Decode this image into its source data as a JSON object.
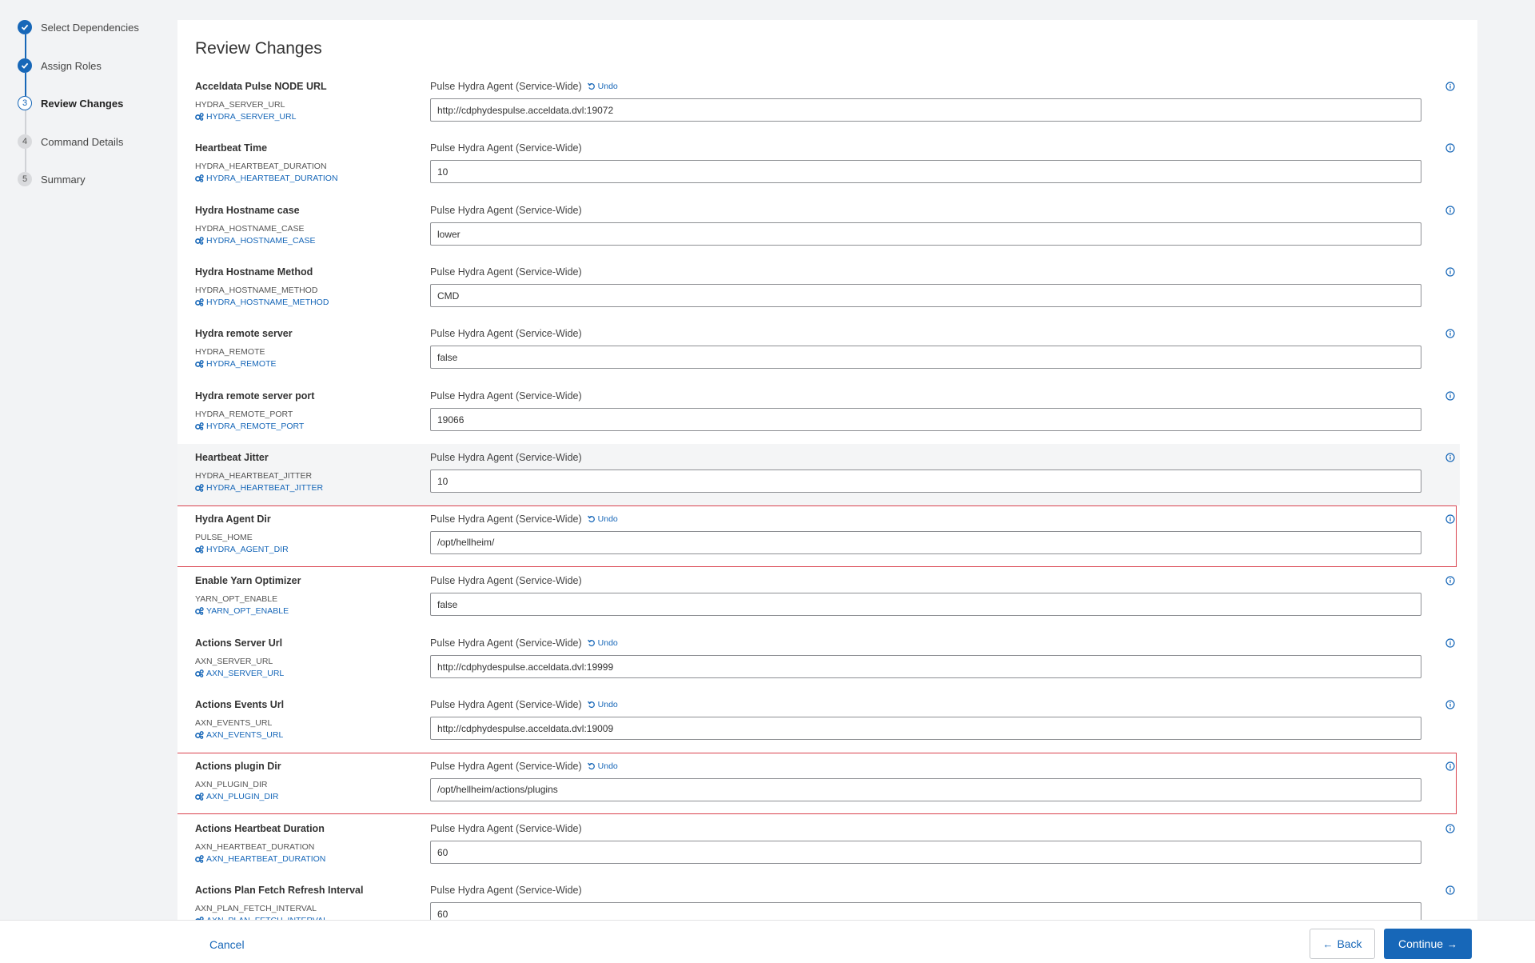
{
  "steps": [
    {
      "number": "1",
      "label": "Select Dependencies",
      "status": "done"
    },
    {
      "number": "2",
      "label": "Assign Roles",
      "status": "done"
    },
    {
      "number": "3",
      "label": "Review Changes",
      "status": "current"
    },
    {
      "number": "4",
      "label": "Command Details",
      "status": "future"
    },
    {
      "number": "5",
      "label": "Summary",
      "status": "future"
    }
  ],
  "page_title": "Review Changes",
  "undo_label": "Undo",
  "properties": [
    {
      "name": "Acceldata Pulse NODE URL",
      "key": "HYDRA_SERVER_URL",
      "link": "HYDRA_SERVER_URL",
      "scope": "Pulse Hydra Agent (Service-Wide)",
      "value": "http://cdphydespulse.acceldata.dvl:19072",
      "undo": true,
      "highlight": "none"
    },
    {
      "name": "Heartbeat Time",
      "key": "HYDRA_HEARTBEAT_DURATION",
      "link": "HYDRA_HEARTBEAT_DURATION",
      "scope": "Pulse Hydra Agent (Service-Wide)",
      "value": "10",
      "undo": false,
      "highlight": "none"
    },
    {
      "name": "Hydra Hostname case",
      "key": "HYDRA_HOSTNAME_CASE",
      "link": "HYDRA_HOSTNAME_CASE",
      "scope": "Pulse Hydra Agent (Service-Wide)",
      "value": "lower",
      "undo": false,
      "highlight": "none"
    },
    {
      "name": "Hydra Hostname Method",
      "key": "HYDRA_HOSTNAME_METHOD",
      "link": "HYDRA_HOSTNAME_METHOD",
      "scope": "Pulse Hydra Agent (Service-Wide)",
      "value": "CMD",
      "undo": false,
      "highlight": "none"
    },
    {
      "name": "Hydra remote server",
      "key": "HYDRA_REMOTE",
      "link": "HYDRA_REMOTE",
      "scope": "Pulse Hydra Agent (Service-Wide)",
      "value": "false",
      "undo": false,
      "highlight": "none"
    },
    {
      "name": "Hydra remote server port",
      "key": "HYDRA_REMOTE_PORT",
      "link": "HYDRA_REMOTE_PORT",
      "scope": "Pulse Hydra Agent (Service-Wide)",
      "value": "19066",
      "undo": false,
      "highlight": "none"
    },
    {
      "name": "Heartbeat Jitter",
      "key": "HYDRA_HEARTBEAT_JITTER",
      "link": "HYDRA_HEARTBEAT_JITTER",
      "scope": "Pulse Hydra Agent (Service-Wide)",
      "value": "10",
      "undo": false,
      "highlight": "hover"
    },
    {
      "name": "Hydra Agent Dir",
      "key": "PULSE_HOME",
      "link": "HYDRA_AGENT_DIR",
      "scope": "Pulse Hydra Agent (Service-Wide)",
      "value": "/opt/hellheim/",
      "undo": true,
      "highlight": "flagged"
    },
    {
      "name": "Enable Yarn Optimizer",
      "key": "YARN_OPT_ENABLE",
      "link": "YARN_OPT_ENABLE",
      "scope": "Pulse Hydra Agent (Service-Wide)",
      "value": "false",
      "undo": false,
      "highlight": "none"
    },
    {
      "name": "Actions Server Url",
      "key": "AXN_SERVER_URL",
      "link": "AXN_SERVER_URL",
      "scope": "Pulse Hydra Agent (Service-Wide)",
      "value": "http://cdphydespulse.acceldata.dvl:19999",
      "undo": true,
      "highlight": "none"
    },
    {
      "name": "Actions Events Url",
      "key": "AXN_EVENTS_URL",
      "link": "AXN_EVENTS_URL",
      "scope": "Pulse Hydra Agent (Service-Wide)",
      "value": "http://cdphydespulse.acceldata.dvl:19009",
      "undo": true,
      "highlight": "none"
    },
    {
      "name": "Actions plugin Dir",
      "key": "AXN_PLUGIN_DIR",
      "link": "AXN_PLUGIN_DIR",
      "scope": "Pulse Hydra Agent (Service-Wide)",
      "value": "/opt/hellheim/actions/plugins",
      "undo": true,
      "highlight": "flagged"
    },
    {
      "name": "Actions Heartbeat Duration",
      "key": "AXN_HEARTBEAT_DURATION",
      "link": "AXN_HEARTBEAT_DURATION",
      "scope": "Pulse Hydra Agent (Service-Wide)",
      "value": "60",
      "undo": false,
      "highlight": "none"
    },
    {
      "name": "Actions Plan Fetch Refresh Interval",
      "key": "AXN_PLAN_FETCH_INTERVAL",
      "link": "AXN_PLAN_FETCH_INTERVAL",
      "scope": "Pulse Hydra Agent (Service-Wide)",
      "value": "60",
      "undo": false,
      "highlight": "none"
    }
  ],
  "footer": {
    "cancel_label": "Cancel",
    "back_label": "Back",
    "continue_label": "Continue"
  },
  "colors": {
    "accent": "#1767b8",
    "flag_border": "#d9424e",
    "hover_row": "#f4f5f6"
  },
  "icons": {
    "step_done": "check-icon",
    "undo": "undo-icon",
    "link": "cogs-icon",
    "info": "info-icon",
    "back": "arrow-left-icon",
    "continue": "arrow-right-icon"
  }
}
